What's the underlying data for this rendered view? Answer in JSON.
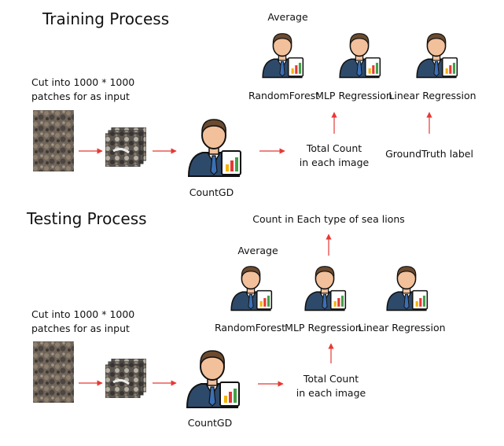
{
  "training": {
    "title": "Training Process",
    "cut_line1": "Cut into  1000 * 1000",
    "cut_line2": "patches for as input",
    "average": "Average",
    "model_random_forest": "RandomForest",
    "model_mlp": "MLP Regression",
    "model_linear": "Linear Regression",
    "countgd": "CountGD",
    "total_count_line1": "Total Count",
    "total_count_line2": "in each image",
    "groundtruth": "GroundTruth label"
  },
  "testing": {
    "title": "Testing Process",
    "cut_line1": "Cut into  1000 * 1000",
    "cut_line2": "patches for as input",
    "average": "Average",
    "model_random_forest": "RandomForest",
    "model_mlp": "MLP Regression",
    "model_linear": "Linear Regression",
    "countgd": "CountGD",
    "total_count_line1": "Total Count",
    "total_count_line2": "in each image",
    "output": "Count in Each type of  sea lions"
  },
  "colors": {
    "arrow": "#e53935",
    "skin": "#f2c09b",
    "hair": "#6b4a2f",
    "suit": "#2e4a6b",
    "tie": "#3a6fb5",
    "doc": "#ffffff"
  },
  "icons": {
    "person": "person-with-chart-document-icon",
    "patch": "aerial-photo-patch"
  }
}
